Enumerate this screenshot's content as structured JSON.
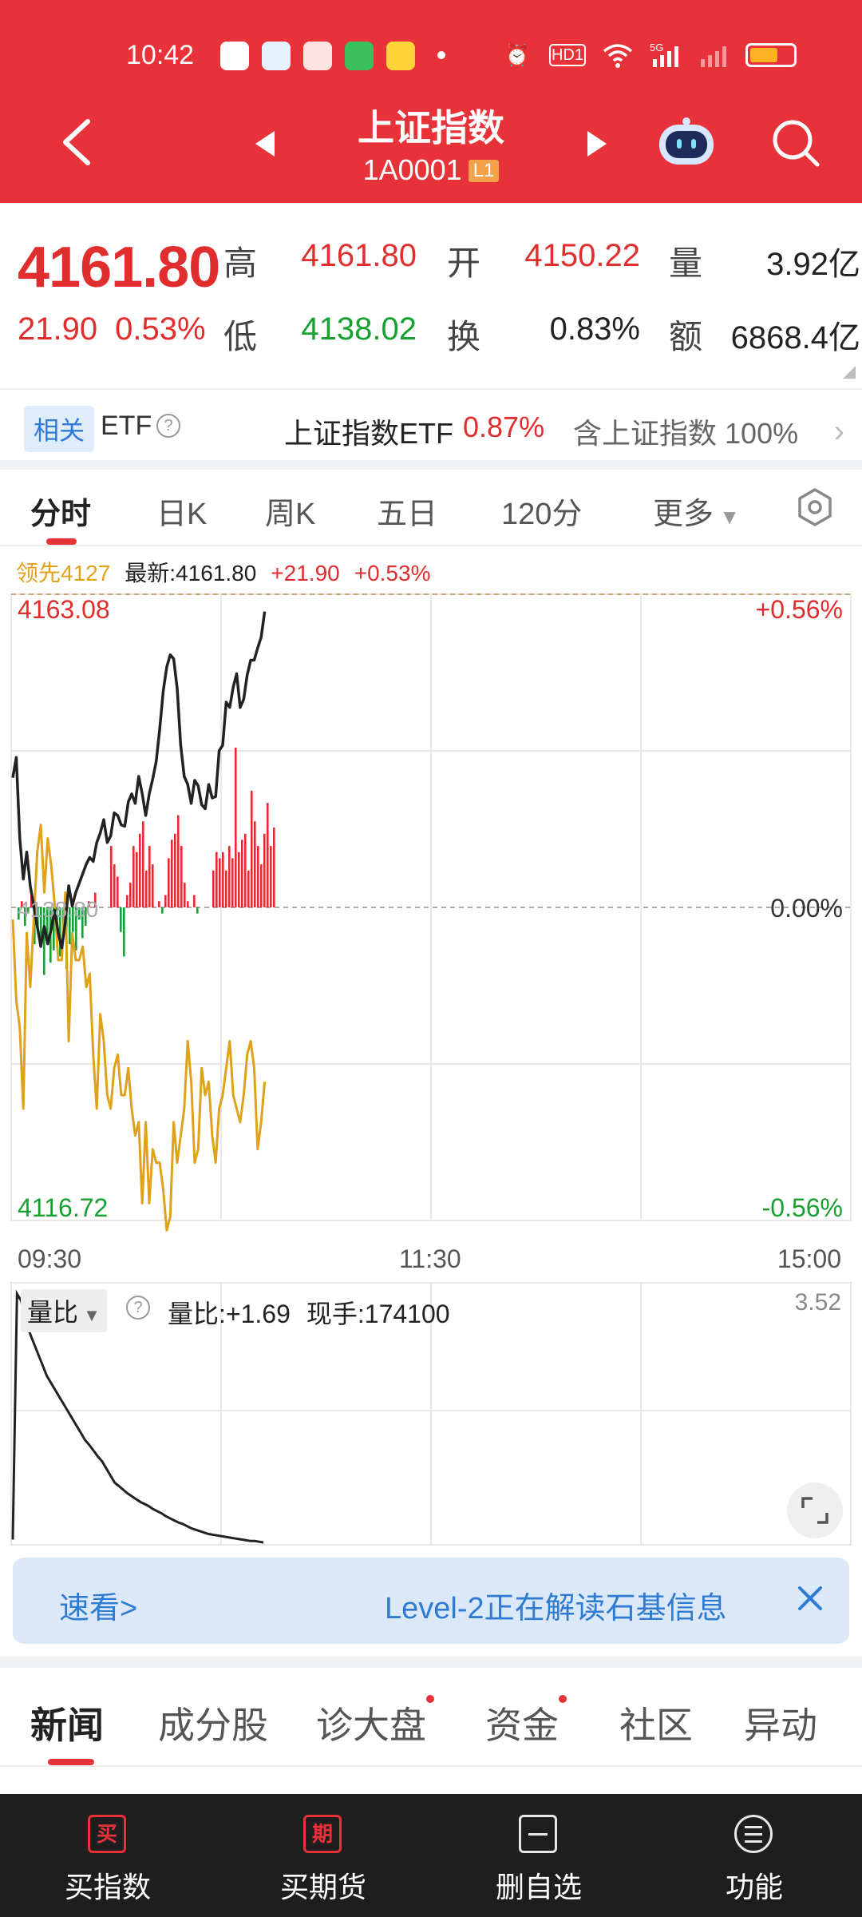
{
  "status_bar": {
    "time": "10:42",
    "hd_label": "HD1",
    "network_label": "5G"
  },
  "header": {
    "title": "上证指数",
    "code": "1A0001",
    "level_badge": "L1"
  },
  "quote": {
    "price": "4161.80",
    "change": "21.90",
    "change_pct": "0.53%",
    "high_label": "高",
    "high": "4161.80",
    "open_label": "开",
    "open": "4150.22",
    "volume_label": "量",
    "volume": "3.92亿",
    "low_label": "低",
    "low": "4138.02",
    "turnover_label": "换",
    "turnover": "0.83%",
    "amount_label": "额",
    "amount": "6868.4亿"
  },
  "etf": {
    "tag": "相关",
    "label": "ETF",
    "name": "上证指数ETF",
    "change_pct": "0.87%",
    "holds_label": "含上证指数",
    "holds_pct": "100%"
  },
  "chart_tabs": [
    "分时",
    "日K",
    "周K",
    "五日",
    "120分",
    "更多"
  ],
  "info_line": {
    "lead": "领先4127",
    "latest": "最新:4161.80",
    "change": "+21.90",
    "change_pct": "+0.53%"
  },
  "chart_data": {
    "type": "line",
    "title": "",
    "x_labels": [
      "09:30",
      "11:30",
      "15:00"
    ],
    "ylim": [
      4116.72,
      4163.08
    ],
    "y_labels": {
      "top": "4163.08",
      "bottom": "4116.72",
      "prev_close": "4138.80"
    },
    "pct_labels": {
      "top": "+0.56%",
      "mid": "0.00%",
      "bottom": "-0.56%"
    },
    "series": [
      {
        "name": "最新",
        "color": "#222222",
        "values": [
          4149.5,
          4151,
          4145,
          4142,
          4144,
          4141.5,
          4140,
          4138.5,
          4137,
          4138.5,
          4137.2,
          4138.3,
          4139.7,
          4138,
          4136.9,
          4138.8,
          4141.5,
          4140,
          4141,
          4141.7,
          4142.4,
          4143.1,
          4143.6,
          4143.3,
          4144.7,
          4145.4,
          4146.4,
          4144.7,
          4145.2,
          4146.9,
          4146.7,
          4146,
          4145.9,
          4147.7,
          4148.3,
          4147.6,
          4149.6,
          4148.3,
          4146.7,
          4148.3,
          4149.4,
          4150.7,
          4153.1,
          4155.9,
          4157.7,
          4158.6,
          4158.3,
          4156.1,
          4151.9,
          4149.6,
          4149,
          4147.6,
          4149.3,
          4148.9,
          4147.5,
          4147.2,
          4149,
          4148,
          4148.1,
          4151.5,
          4151.9,
          4155.1,
          4154.7,
          4156.2,
          4157.2,
          4154.7,
          4155.3,
          4157.1,
          4158.2,
          4158.2,
          4159.1,
          4159.9,
          4161.8
        ]
      },
      {
        "name": "领先",
        "color": "#e0a21a",
        "values": [
          4139,
          4133,
          4131,
          4125,
          4138,
          4134,
          4139,
          4144,
          4146,
          4141,
          4145,
          4143,
          4140,
          4136,
          4136,
          4141,
          4130,
          4138,
          4136,
          4136,
          4137,
          4134,
          4135,
          4129,
          4125,
          4132,
          4130,
          4126,
          4125,
          4128,
          4129,
          4126,
          4126,
          4128,
          4125,
          4123,
          4124,
          4118,
          4124,
          4118,
          4122,
          4121,
          4121,
          4119,
          4116,
          4117,
          4124,
          4121,
          4123,
          4125,
          4130,
          4127,
          4121,
          4122,
          4128,
          4126,
          4127,
          4123,
          4121,
          4125,
          4126,
          4128,
          4130,
          4126,
          4125,
          4124,
          4126,
          4129,
          4130,
          4128,
          4122,
          4124,
          4127
        ]
      }
    ],
    "volume_bars": [
      0,
      -0.1,
      0.05,
      -0.15,
      -0.05,
      0.1,
      -0.3,
      -0.2,
      -0.25,
      -0.55,
      -0.3,
      -0.45,
      -0.35,
      -0.2,
      -0.4,
      -0.25,
      -0.5,
      -0.3,
      -0.2,
      -0.35,
      -0.1,
      -0.25,
      -0.15,
      0.05,
      0,
      0.12,
      0,
      0,
      0,
      0,
      0.5,
      0.35,
      0.25,
      -0.2,
      -0.4,
      0.1,
      0.2,
      0.5,
      0.45,
      0.6,
      0.7,
      0.3,
      0.5,
      0.35,
      0,
      0.05,
      -0.05,
      0.1,
      0.4,
      0.55,
      0.6,
      0.75,
      0.5,
      0.2,
      0.05,
      0,
      0.1,
      -0.05,
      0,
      0,
      0,
      0,
      0.3,
      0.45,
      0.4,
      0.45,
      0.3,
      0.5,
      0.4,
      1.3,
      0.45,
      0.55,
      0.6,
      0.3,
      0.95,
      0.7,
      0.5,
      0.35,
      0.6,
      0.85,
      0.5,
      0.65
    ],
    "volume_ratio": {
      "ylim": [
        0,
        3.52
      ],
      "values": [
        0.05,
        3.5,
        3.4,
        3.1,
        2.95,
        2.8,
        2.65,
        2.5,
        2.35,
        2.25,
        2.15,
        2.05,
        1.95,
        1.85,
        1.75,
        1.65,
        1.55,
        1.45,
        1.38,
        1.3,
        1.22,
        1.15,
        1.05,
        0.95,
        0.85,
        0.8,
        0.75,
        0.7,
        0.66,
        0.62,
        0.58,
        0.55,
        0.52,
        0.48,
        0.45,
        0.42,
        0.38,
        0.35,
        0.32,
        0.29,
        0.27,
        0.24,
        0.21,
        0.19,
        0.17,
        0.15,
        0.13,
        0.12,
        0.11,
        0.1,
        0.09,
        0.08,
        0.07,
        0.06,
        0.05,
        0.04,
        0.03,
        0.03,
        0.02,
        0.01
      ]
    }
  },
  "volume_panel": {
    "selector": "量比",
    "ratio": "量比:+1.69",
    "current_hand": "现手:174100",
    "max": "3.52"
  },
  "banner": {
    "label": "速看>",
    "text": "Level-2正在解读石基信息"
  },
  "news_tabs": [
    "新闻",
    "成分股",
    "诊大盘",
    "资金",
    "社区",
    "异动"
  ],
  "bottom_bar": [
    {
      "icon_char": "买",
      "label": "买指数"
    },
    {
      "icon_char": "期",
      "label": "买期货"
    },
    {
      "icon_char": "",
      "label": "删自选"
    },
    {
      "icon_char": "",
      "label": "功能"
    }
  ],
  "colors": {
    "header_red": "#e8323a",
    "up": "#e02e2e",
    "down": "#18a132",
    "lead_line": "#e0a21a",
    "bottom_bar": "#1e1e1e"
  }
}
